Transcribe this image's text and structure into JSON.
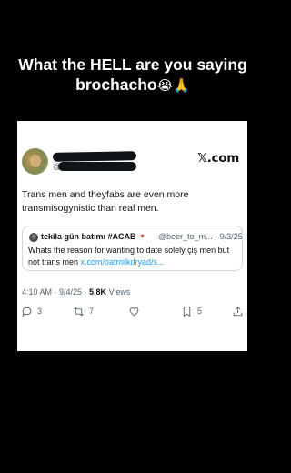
{
  "caption": {
    "line1": "What the HELL are you saying",
    "line2": "brochacho",
    "emoji": "😭🙏"
  },
  "card": {
    "brand": "𝕏.com",
    "handle_prefix": "@",
    "tweet_text": "Trans men and theyfabs are even more transmisogynistic than real men.",
    "quote": {
      "name": "tekila gün batımı #ACAB",
      "flag": "🔻",
      "meta": "@beer_to_m... · 9/3/25",
      "text": "Whats the reason for wanting to date solely çiş men but not trans men ",
      "link": "x.com/oatmilkdryad/s..."
    },
    "timestamp": {
      "time": "4:10 AM · 9/4/25 · ",
      "views_count": "5.8K",
      "views_label": " Views"
    },
    "actions": {
      "reply_count": "3",
      "repost_count": "7",
      "like_count": "",
      "bookmark_count": "5",
      "icons": [
        "reply-icon",
        "repost-icon",
        "like-icon",
        "bookmark-icon",
        "share-icon"
      ]
    }
  }
}
